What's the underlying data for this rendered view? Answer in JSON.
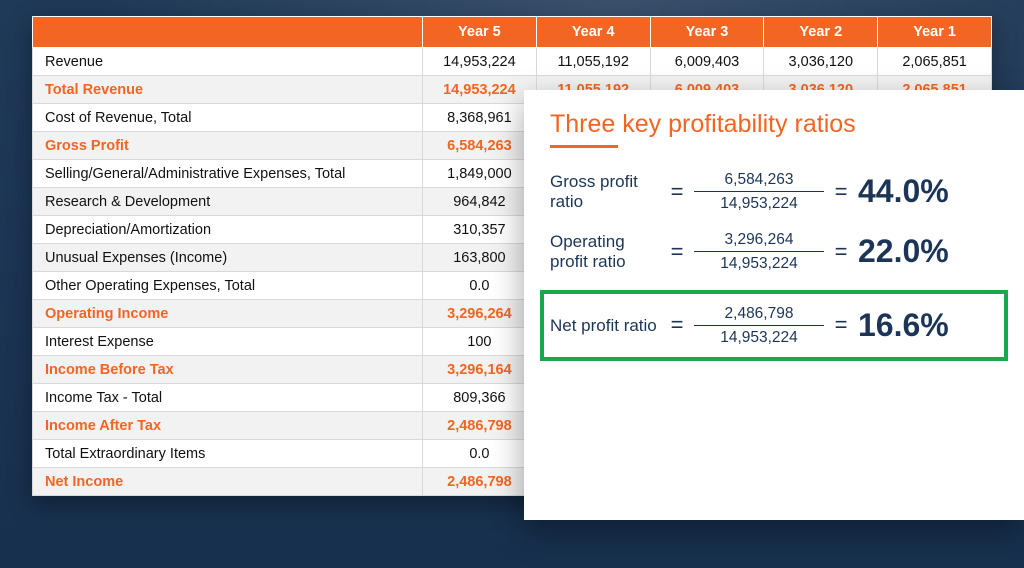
{
  "colors": {
    "accent": "#f26522",
    "ink": "#1c3557",
    "highlight": "#1aa94a"
  },
  "table": {
    "years": [
      "Year 5",
      "Year 4",
      "Year 3",
      "Year 2",
      "Year 1"
    ],
    "rows": [
      {
        "label": "Revenue",
        "emph": false,
        "cells": [
          "14,953,224",
          "11,055,192",
          "6,009,403",
          "3,036,120",
          "2,065,851"
        ]
      },
      {
        "label": "Total Revenue",
        "emph": true,
        "cells": [
          "14,953,224",
          "11,055,192",
          "6,009,403",
          "3,036,120",
          "2,065,851"
        ]
      },
      {
        "label": "Cost of Revenue, Total",
        "emph": false,
        "cells": [
          "8,368,961",
          "",
          "",
          "",
          ""
        ]
      },
      {
        "label": "Gross Profit",
        "emph": true,
        "cells": [
          "6,584,263",
          "",
          "",
          "",
          ""
        ]
      },
      {
        "label": "Selling/General/Administrative Expenses, Total",
        "emph": false,
        "cells": [
          "1,849,000",
          "",
          "",
          "",
          ""
        ]
      },
      {
        "label": "Research & Development",
        "emph": false,
        "cells": [
          "964,842",
          "",
          "",
          "",
          ""
        ]
      },
      {
        "label": "Depreciation/Amortization",
        "emph": false,
        "cells": [
          "310,357",
          "",
          "",
          "",
          ""
        ]
      },
      {
        "label": "Unusual Expenses (Income)",
        "emph": false,
        "cells": [
          "163,800",
          "",
          "",
          "",
          ""
        ]
      },
      {
        "label": "Other Operating Expenses, Total",
        "emph": false,
        "cells": [
          "0.0",
          "",
          "",
          "",
          ""
        ]
      },
      {
        "label": "Operating Income",
        "emph": true,
        "cells": [
          "3,296,264",
          "",
          "",
          "",
          ""
        ]
      },
      {
        "label": "Interest Expense",
        "emph": false,
        "cells": [
          "100",
          "",
          "",
          "",
          ""
        ]
      },
      {
        "label": "Income Before Tax",
        "emph": true,
        "cells": [
          "3,296,164",
          "",
          "",
          "",
          ""
        ]
      },
      {
        "label": "Income Tax - Total",
        "emph": false,
        "cells": [
          "809,366",
          "",
          "",
          "",
          ""
        ]
      },
      {
        "label": "Income After Tax",
        "emph": true,
        "cells": [
          "2,486,798",
          "",
          "",
          "",
          ""
        ]
      },
      {
        "label": "Total Extraordinary Items",
        "emph": false,
        "cells": [
          "0.0",
          "",
          "",
          "",
          ""
        ]
      },
      {
        "label": "Net Income",
        "emph": true,
        "cells": [
          "2,486,798",
          "",
          "",
          "",
          ""
        ]
      }
    ]
  },
  "ratios": {
    "title": "Three key profitability ratios",
    "items": [
      {
        "label": "Gross profit ratio",
        "numerator": "6,584,263",
        "denominator": "14,953,224",
        "pct": "44.0%",
        "highlight": false
      },
      {
        "label": "Operating profit ratio",
        "numerator": "3,296,264",
        "denominator": "14,953,224",
        "pct": "22.0%",
        "highlight": false
      },
      {
        "label": "Net profit ratio",
        "numerator": "2,486,798",
        "denominator": "14,953,224",
        "pct": "16.6%",
        "highlight": true
      }
    ],
    "eq": "="
  }
}
